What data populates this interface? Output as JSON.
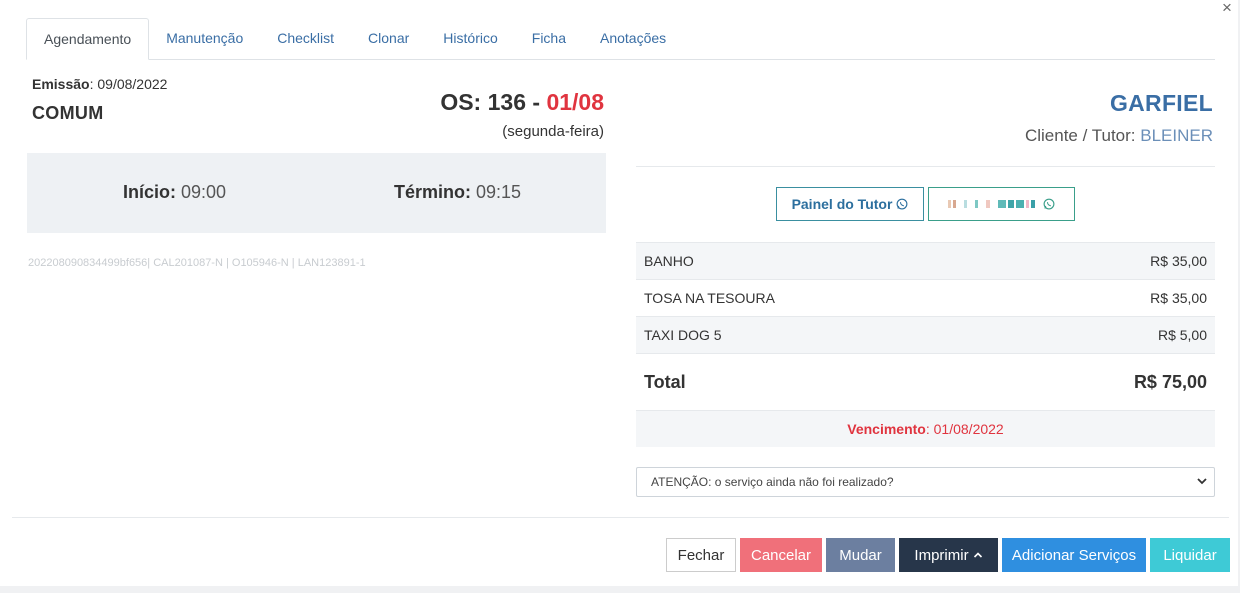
{
  "close_label": "×",
  "tabs": [
    {
      "label": "Agendamento"
    },
    {
      "label": "Manutenção"
    },
    {
      "label": "Checklist"
    },
    {
      "label": "Clonar"
    },
    {
      "label": "Histórico"
    },
    {
      "label": "Ficha"
    },
    {
      "label": "Anotações"
    }
  ],
  "left": {
    "emissao_label": "Emissão",
    "emissao_value": ": 09/08/2022",
    "tipo": "COMUM",
    "os_label": "OS: 136 - ",
    "os_date": "01/08",
    "weekday": "(segunda-feira)",
    "inicio_label": "Início:",
    "inicio_value": " 09:00",
    "termino_label": "Término:",
    "termino_value": " 09:15",
    "codes": "202208090834499bf656| CAL201087-N | O105946-N | LAN123891-1"
  },
  "right": {
    "pet_name": "GARFIEL",
    "cliente_label": "Cliente / Tutor: ",
    "tutor_name": "BLEINER",
    "painel_label": "Painel do Tutor",
    "services": [
      {
        "name": "BANHO",
        "price": "R$ 35,00"
      },
      {
        "name": "TOSA NA TESOURA",
        "price": "R$ 35,00"
      },
      {
        "name": "TAXI DOG 5",
        "price": "R$ 5,00"
      }
    ],
    "total_label": "Total",
    "total_value": "R$ 75,00",
    "vencimento_label": "Vencimento",
    "vencimento_value": ": 01/08/2022",
    "select_value": "ATENÇÃO: o serviço ainda não foi realizado?"
  },
  "footer": {
    "fechar": "Fechar",
    "cancelar": "Cancelar",
    "mudar": "Mudar",
    "imprimir": "Imprimir",
    "adicionar": "Adicionar Serviços",
    "liquidar": "Liquidar"
  },
  "colors": {
    "accent_blue": "#3a6ea5",
    "danger_red": "#e0343f",
    "whatsapp_green": "#3a9f8a"
  }
}
